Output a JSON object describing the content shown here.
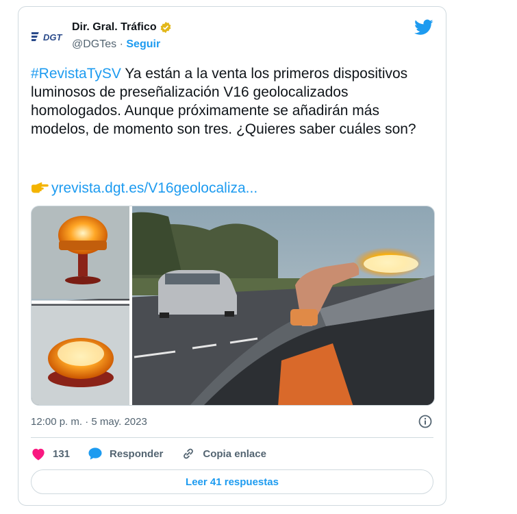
{
  "tweet": {
    "author_name": "Dir. Gral. Tráfico",
    "handle": "@DGTes",
    "separator": "·",
    "follow_label": "Seguir",
    "logo_text": "DGT",
    "hashtag": "#RevistaTySV",
    "body_text": " Ya están a la venta los primeros dispositivos luminosos de preseñalización V16 geolocalizados homologados. Aunque próximamente se añadirán más modelos, de momento son tres. ¿Quieres saber cuáles son?",
    "link_text": "yrevista.dgt.es/V16geolocaliza...",
    "timestamp": "12:00 p. m. · 5 may. 2023",
    "likes_count": "131",
    "reply_label": "Responder",
    "copy_link_label": "Copia enlace",
    "read_replies_label": "Leer 41 respuestas"
  },
  "colors": {
    "accent": "#1d9bf0",
    "like": "#f91880",
    "verified_gold": "#e2b719",
    "muted": "#536471"
  },
  "icons": [
    "dgt-logo-icon",
    "verified-badge-icon",
    "twitter-bird-icon",
    "pointing-finger-icon",
    "info-icon",
    "heart-icon",
    "reply-bubble-icon",
    "link-icon"
  ]
}
